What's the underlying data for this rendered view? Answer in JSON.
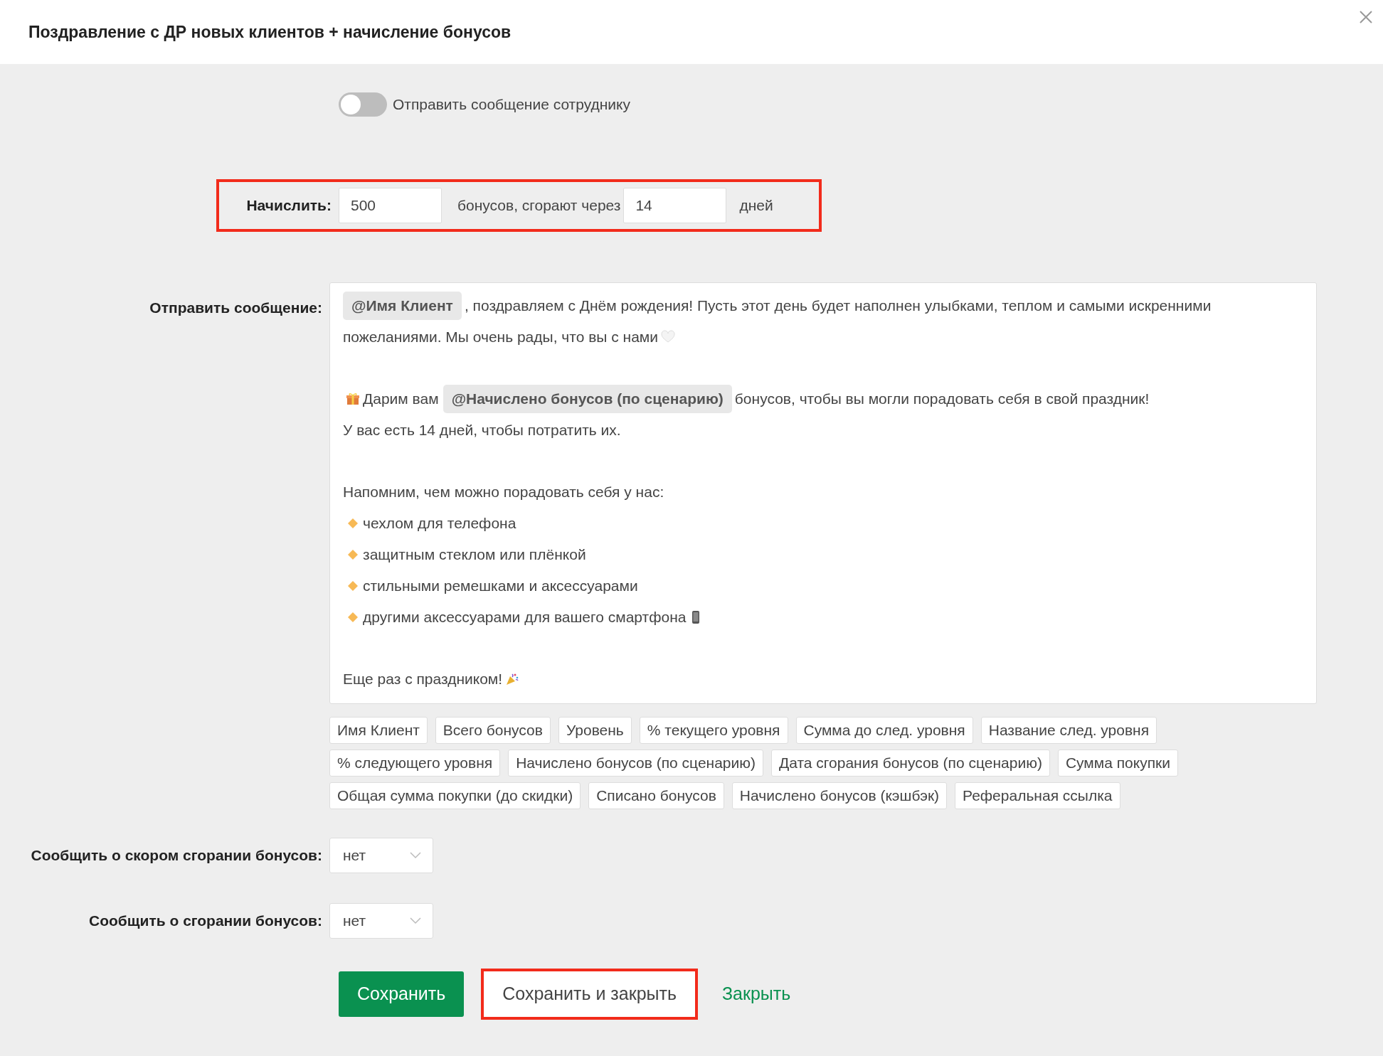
{
  "dialog": {
    "title": "Поздравление с ДР новых клиентов + начисление бонусов"
  },
  "toggles": [
    {
      "label": "Отправить сообщение сотруднику",
      "on": false
    }
  ],
  "accrual": {
    "label": "Начислить:",
    "amount": "500",
    "middle_text": "бонусов, сгорают через",
    "days": "14",
    "unit": "дней",
    "highlighted": true
  },
  "message": {
    "label": "Отправить сообщение:",
    "lines": [
      {
        "segments": [
          {
            "kind": "chip",
            "text": "@Имя Клиент"
          },
          {
            "kind": "text",
            "text": ", поздравляем с Днём рождения! Пусть этот день будет наполнен улыбками, теплом и самыми искренними"
          }
        ]
      },
      {
        "segments": [
          {
            "kind": "text",
            "text": "пожеланиями. Мы очень рады, что вы с нами"
          },
          {
            "kind": "heart"
          }
        ]
      },
      {
        "space_before": true,
        "segments": [
          {
            "kind": "gift"
          },
          {
            "kind": "text",
            "text": "Дарим вам"
          },
          {
            "kind": "chip",
            "text": "@Начислено бонусов (по сценарию)"
          },
          {
            "kind": "text",
            "text": "бонусов, чтобы вы могли порадовать себя в свой праздник!"
          }
        ]
      },
      {
        "segments": [
          {
            "kind": "text",
            "text": "У вас есть 14 дней, чтобы потратить их."
          }
        ]
      },
      {
        "space_before": true,
        "segments": [
          {
            "kind": "text",
            "text": "Напомним, чем можно порадовать себя у нас:"
          }
        ]
      },
      {
        "segments": [
          {
            "kind": "diamond"
          },
          {
            "kind": "text",
            "text": "чехлом для телефона"
          }
        ]
      },
      {
        "segments": [
          {
            "kind": "diamond"
          },
          {
            "kind": "text",
            "text": "защитным стеклом или плёнкой"
          }
        ]
      },
      {
        "segments": [
          {
            "kind": "diamond"
          },
          {
            "kind": "text",
            "text": "стильными ремешками и аксессуарами"
          }
        ]
      },
      {
        "segments": [
          {
            "kind": "diamond"
          },
          {
            "kind": "text",
            "text": "другими аксессуарами для вашего смартфона"
          },
          {
            "kind": "phone"
          }
        ]
      },
      {
        "space_before": true,
        "segments": [
          {
            "kind": "text",
            "text": "Еще раз с праздником!"
          },
          {
            "kind": "party"
          }
        ]
      }
    ]
  },
  "variables": [
    "Имя Клиент",
    "Всего бонусов",
    "Уровень",
    "% текущего уровня",
    "Сумма до след. уровня",
    "Название след. уровня",
    "% следующего уровня",
    "Начислено бонусов (по сценарию)",
    "Дата сгорания бонусов (по сценарию)",
    "Сумма покупки",
    "Общая сумма покупки (до скидки)",
    "Списано бонусов",
    "Начислено бонусов (кэшбэк)",
    "Реферальная ссылка"
  ],
  "selects": [
    {
      "label": "Сообщить о скором сгорании бонусов:",
      "value": "нет"
    },
    {
      "label": "Сообщить о сгорании бонусов:",
      "value": "нет"
    }
  ],
  "buttons": [
    {
      "kind": "primary",
      "label": "Сохранить",
      "highlighted": false
    },
    {
      "kind": "secondary",
      "label": "Сохранить и закрыть",
      "highlighted": true
    },
    {
      "kind": "link",
      "label": "Закрыть",
      "highlighted": false
    }
  ]
}
